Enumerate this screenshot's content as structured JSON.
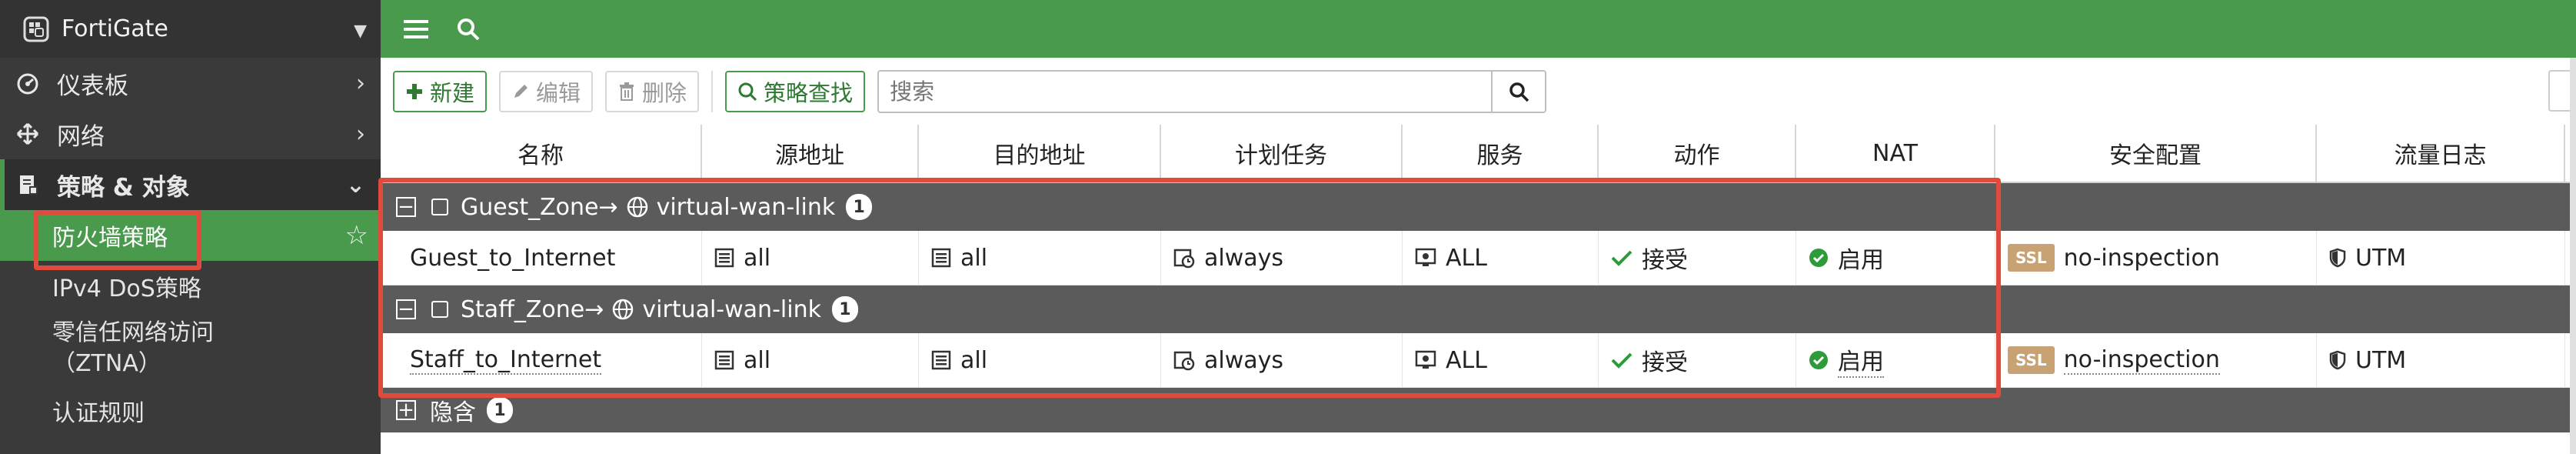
{
  "sidebar": {
    "app_title": "FortiGate",
    "items": [
      {
        "label": "仪表板",
        "icon": "dashboard-icon"
      },
      {
        "label": "网络",
        "icon": "network-icon"
      },
      {
        "label": "策略 & 对象",
        "icon": "policy-icon"
      }
    ],
    "subitems": [
      {
        "label": "防火墙策略"
      },
      {
        "label": "IPv4 DoS策略"
      },
      {
        "label_line1": "零信任网络访问",
        "label_line2": "（ZTNA）"
      },
      {
        "label": "认证规则"
      }
    ]
  },
  "toolbar": {
    "new_label": "新建",
    "edit_label": "编辑",
    "delete_label": "删除",
    "policy_lookup_label": "策略查找",
    "search_placeholder": "搜索"
  },
  "table": {
    "columns": [
      "名称",
      "源地址",
      "目的地址",
      "计划任务",
      "服务",
      "动作",
      "NAT",
      "安全配置",
      "流量日志"
    ],
    "groups": [
      {
        "src_zone": "Guest_Zone",
        "arrow": "→",
        "dst_zone": "virtual-wan-link",
        "count": "1",
        "row": {
          "name": "Guest_to_Internet",
          "src": "all",
          "dst": "all",
          "schedule": "always",
          "service": "ALL",
          "action": "接受",
          "nat": "启用",
          "ssl_badge": "SSL",
          "security": "no-inspection",
          "log": "UTM"
        }
      },
      {
        "src_zone": "Staff_Zone",
        "arrow": "→",
        "dst_zone": "virtual-wan-link",
        "count": "1",
        "row": {
          "name": "Staff_to_Internet",
          "src": "all",
          "dst": "all",
          "schedule": "always",
          "service": "ALL",
          "action": "接受",
          "nat": "启用",
          "ssl_badge": "SSL",
          "security": "no-inspection",
          "log": "UTM"
        }
      }
    ],
    "implicit": {
      "label": "隐含",
      "count": "1"
    }
  },
  "colors": {
    "brand_green": "#4a9a4e",
    "sidebar_bg": "#3a3a3a",
    "highlight_red": "#e04b3e",
    "group_row_bg": "#5b5b5b",
    "accept_green": "#2e9b3a"
  }
}
